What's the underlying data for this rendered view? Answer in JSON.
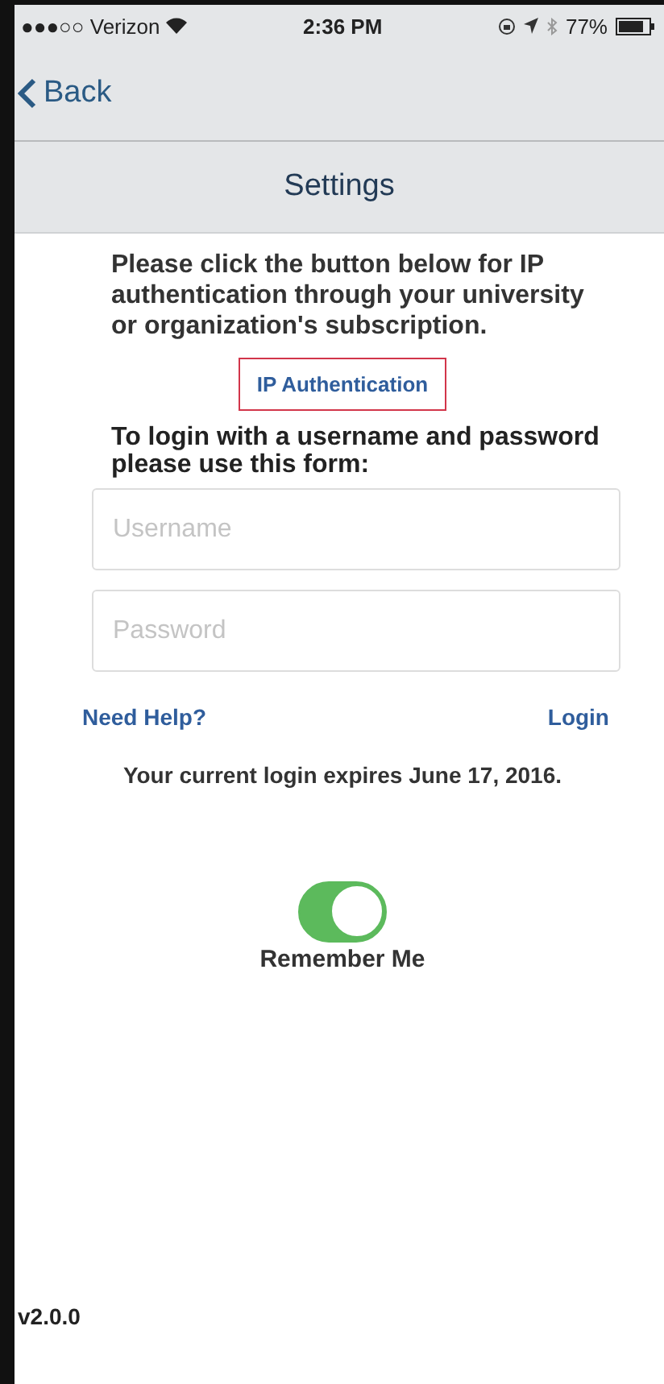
{
  "status_bar": {
    "carrier": "●●●○○ Verizon",
    "time": "2:36 PM",
    "battery": "77%"
  },
  "nav": {
    "back": "Back"
  },
  "title": "Settings",
  "ip_intro": "Please click the button below for IP authentication through your university or organization's subscription.",
  "ip_button": "IP Authentication",
  "form_intro": "To login with a username and password please use this form:",
  "fields": [
    {
      "placeholder": "Username"
    },
    {
      "placeholder": "Password"
    }
  ],
  "links": {
    "help": "Need Help?",
    "login": "Login"
  },
  "expiry": "Your current login expires June 17, 2016.",
  "remember": {
    "label": "Remember Me",
    "on": true
  },
  "version": "v2.0.0"
}
